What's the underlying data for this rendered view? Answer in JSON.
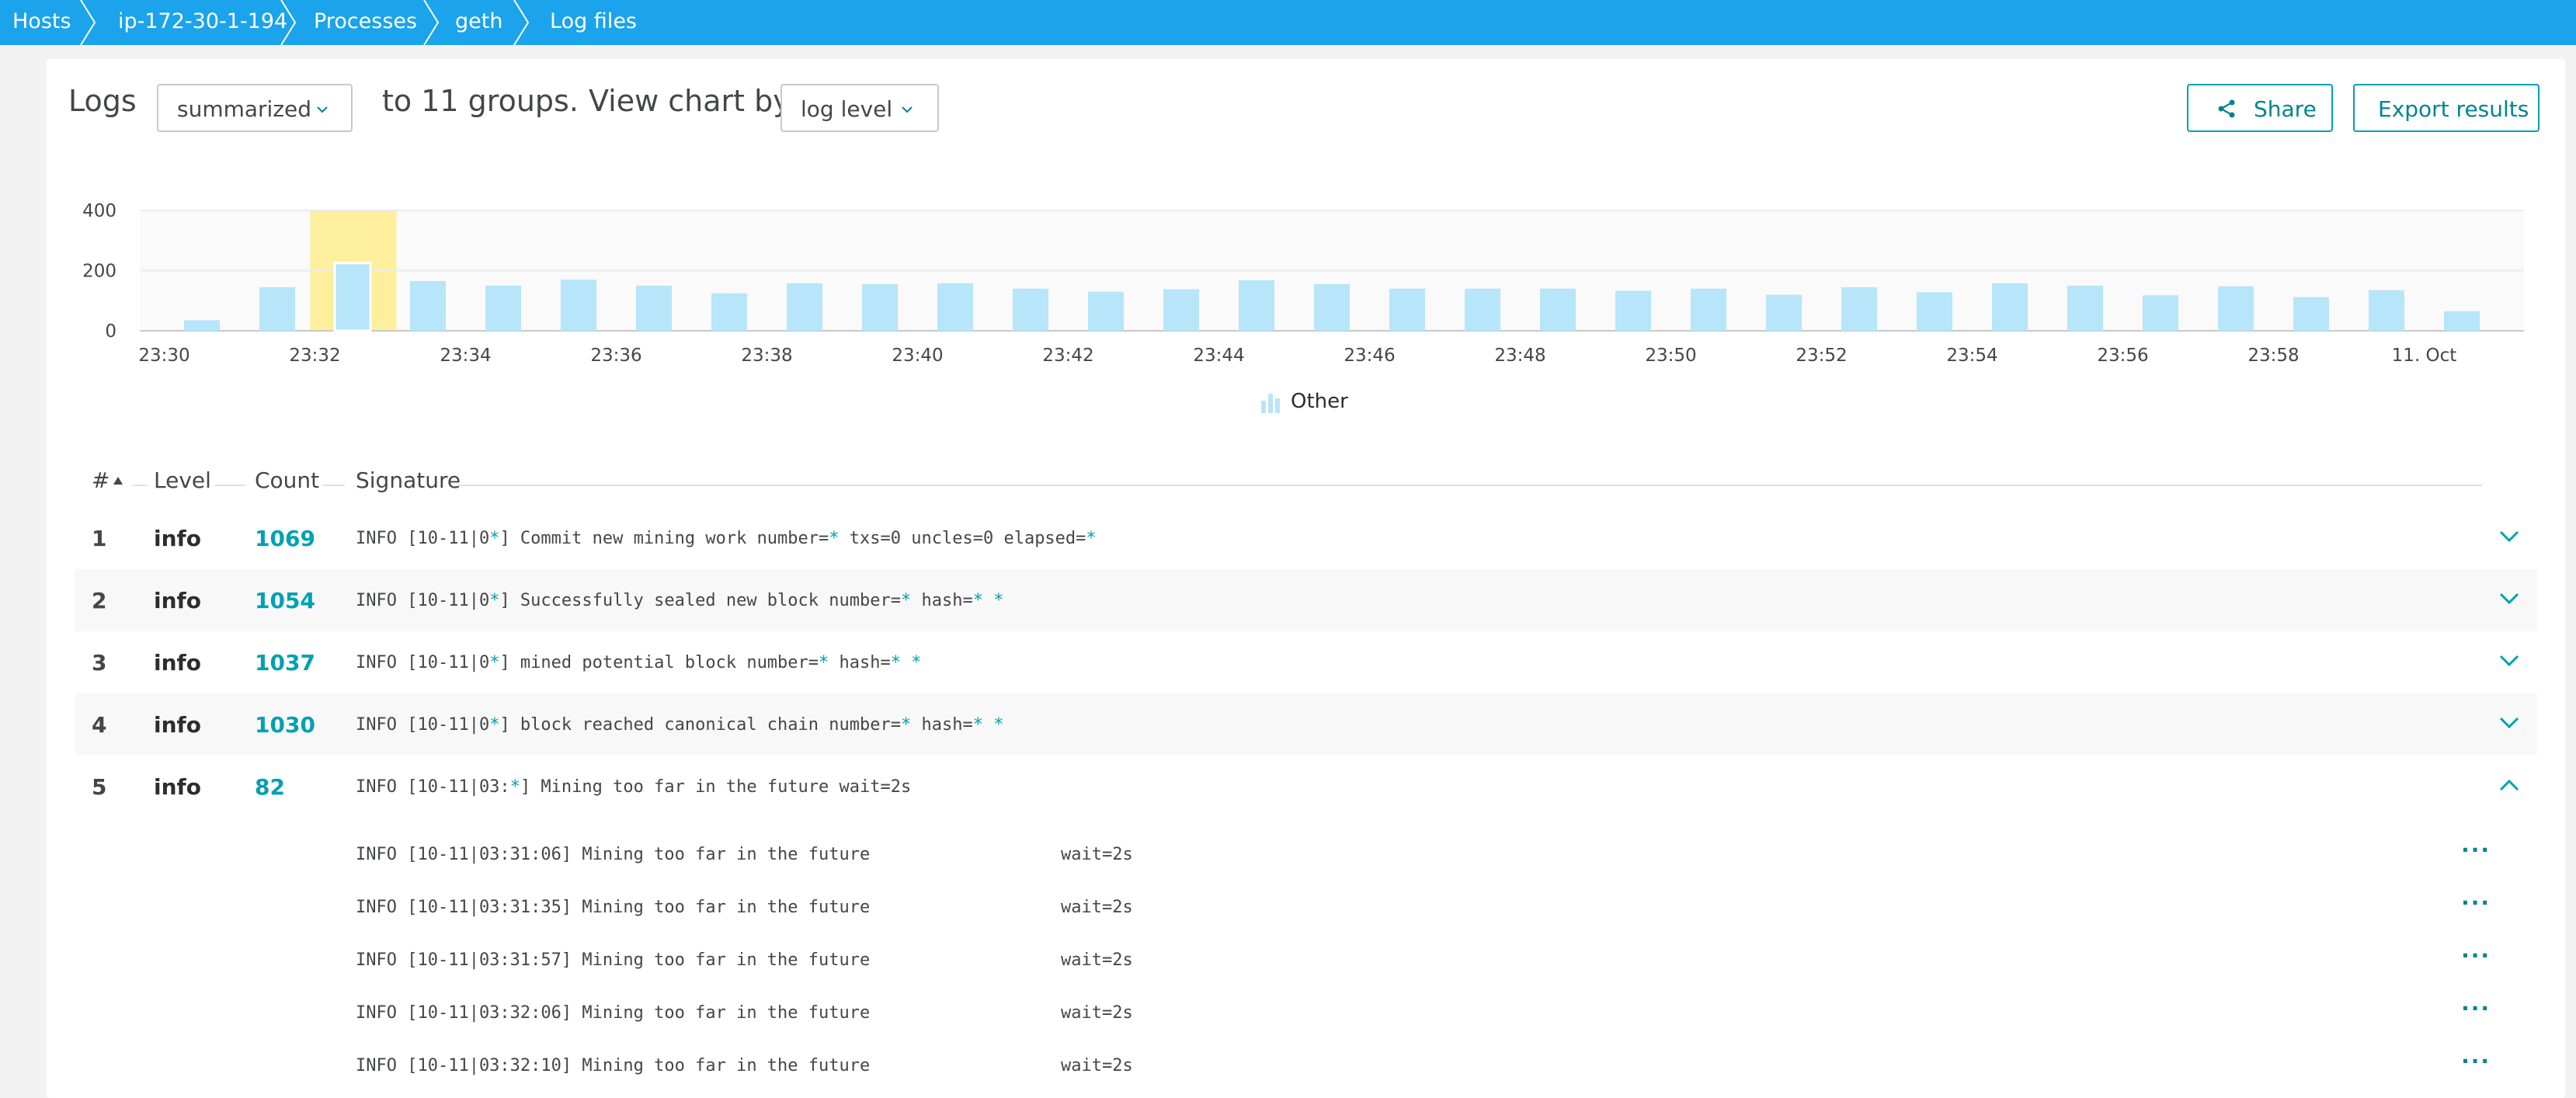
{
  "breadcrumbs": [
    "Hosts",
    "ip-172-30-1-194",
    "Processes",
    "geth",
    "Log files"
  ],
  "toolbar": {
    "logs_label": "Logs",
    "mode_value": "summarized",
    "groups_text": "to 11 groups.",
    "view_chart_label": "View chart by",
    "chart_by_value": "log level",
    "share_label": "Share",
    "export_label": "Export results"
  },
  "colors": {
    "accent": "#00a1b2",
    "breadcrumb_bg": "#1ba3ec",
    "bar": "#b7e5f9",
    "highlight": "#fdef9c"
  },
  "chart_data": {
    "type": "bar",
    "yticks": [
      "0",
      "200",
      "400"
    ],
    "ylim": [
      0,
      400
    ],
    "xticks": [
      "23:30",
      "23:32",
      "23:34",
      "23:36",
      "23:38",
      "23:40",
      "23:42",
      "23:44",
      "23:46",
      "23:48",
      "23:50",
      "23:52",
      "23:54",
      "23:56",
      "23:58",
      "11. Oct"
    ],
    "series": [
      {
        "name": "Other",
        "values": [
          35,
          145,
          225,
          165,
          150,
          170,
          150,
          125,
          158,
          155,
          158,
          140,
          130,
          138,
          168,
          155,
          140,
          140,
          140,
          133,
          140,
          120,
          145,
          128,
          158,
          150,
          118,
          148,
          112,
          135,
          65
        ]
      }
    ],
    "highlight_index": 2,
    "grid": true,
    "legend": "bottom-center"
  },
  "legend": {
    "label": "Other",
    "icon": "bar-chart-icon"
  },
  "table": {
    "headers": {
      "num": "#",
      "level": "Level",
      "count": "Count",
      "signature": "Signature"
    },
    "rows": [
      {
        "num": "1",
        "level": "info",
        "count": "1069",
        "sig": [
          "INFO [10-11|0",
          "*",
          "] Commit new mining work number=",
          "*",
          " txs=0 uncles=0 elapsed=",
          "*"
        ]
      },
      {
        "num": "2",
        "level": "info",
        "count": "1054",
        "sig": [
          "INFO [10-11|0",
          "*",
          "] Successfully sealed new block number=",
          "*",
          " hash=",
          "*",
          " ",
          "*"
        ]
      },
      {
        "num": "3",
        "level": "info",
        "count": "1037",
        "sig": [
          "INFO [10-11|0",
          "*",
          "] mined potential block number=",
          "*",
          " hash=",
          "*",
          " ",
          "*"
        ]
      },
      {
        "num": "4",
        "level": "info",
        "count": "1030",
        "sig": [
          "INFO [10-11|0",
          "*",
          "] block reached canonical chain number=",
          "*",
          " hash=",
          "*",
          " ",
          "*"
        ]
      },
      {
        "num": "5",
        "level": "info",
        "count": "82",
        "sig": [
          "INFO [10-11|03:",
          "*",
          "] Mining too far in the future wait=2s"
        ]
      }
    ],
    "expanded_entries": [
      {
        "msg": "INFO [10-11|03:31:06] Mining too far in the future",
        "kv": "wait=2s"
      },
      {
        "msg": "INFO [10-11|03:31:35] Mining too far in the future",
        "kv": "wait=2s"
      },
      {
        "msg": "INFO [10-11|03:31:57] Mining too far in the future",
        "kv": "wait=2s"
      },
      {
        "msg": "INFO [10-11|03:32:06] Mining too far in the future",
        "kv": "wait=2s"
      },
      {
        "msg": "INFO [10-11|03:32:10] Mining too far in the future",
        "kv": "wait=2s"
      }
    ],
    "more_label": "···"
  }
}
